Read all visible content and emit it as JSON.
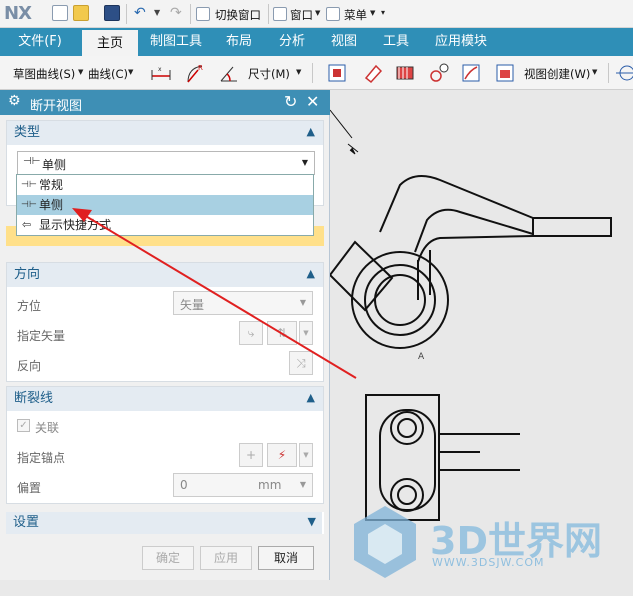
{
  "app": {
    "logo": "NX"
  },
  "quickbar": {
    "switch_window": "切换窗口",
    "window": "窗口",
    "menu": "菜单"
  },
  "menubar": {
    "items": [
      {
        "label": "文件(F)"
      },
      {
        "label": "主页"
      },
      {
        "label": "制图工具"
      },
      {
        "label": "布局"
      },
      {
        "label": "分析"
      },
      {
        "label": "视图"
      },
      {
        "label": "工具"
      },
      {
        "label": "应用模块"
      }
    ],
    "active_index": 1
  },
  "toolbar": {
    "sketch_curve": "草图曲线(S)",
    "curve": "曲线(C)",
    "dimension": "尺寸(M)",
    "view_create": "视图创建(W)"
  },
  "dialog": {
    "title": "断开视图",
    "type_section": {
      "title": "类型",
      "selected": "单侧"
    },
    "dropdown": {
      "items": [
        "常规",
        "单侧",
        "显示快捷方式"
      ],
      "selected_index": 1
    },
    "direction_section": {
      "title": "方向",
      "orientation_label": "方位",
      "orientation_value": "矢量",
      "vector_label": "指定矢量",
      "reverse_label": "反向"
    },
    "breakline_section": {
      "title": "断裂线",
      "associative_label": "关联",
      "anchor_label": "指定锚点",
      "offset_label": "偏置",
      "offset_value": "0",
      "offset_unit": "mm"
    },
    "settings_section": {
      "title": "设置"
    },
    "buttons": {
      "ok": "确定",
      "apply": "应用",
      "cancel": "取消"
    }
  },
  "canvas": {
    "annotation_a": "A",
    "watermark_title": "3D世界网",
    "watermark_url": "WWW.3DSJW.COM"
  },
  "colors": {
    "accent": "#2f8fb7",
    "dialog_title": "#3e8fb5",
    "arrow": "#e02020",
    "selection": "#a8d0e2",
    "highlight_row": "#ffe08a"
  }
}
